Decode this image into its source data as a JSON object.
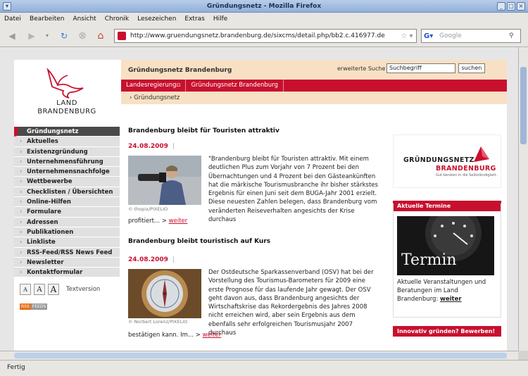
{
  "window": {
    "title": "Gründungsnetz - Mozilla Firefox"
  },
  "menu": [
    "Datei",
    "Bearbeiten",
    "Ansicht",
    "Chronik",
    "Lesezeichen",
    "Extras",
    "Hilfe"
  ],
  "toolbar": {
    "url": "http://www.gruendungsnetz.brandenburg.de/sixcms/detail.php/bb2.c.416977.de",
    "search_placeholder": "Google"
  },
  "status": "Fertig",
  "site": {
    "logo_line1": "LAND",
    "logo_line2": "BRANDENBURG",
    "title": "Gründungsnetz Brandenburg",
    "advanced_search": "erweiterte Suche",
    "search_value": "Suchbegriff",
    "search_button": "suchen",
    "redbar": [
      "Landesregierung",
      "Gründungsnetz Brandenburg"
    ],
    "breadcrumb": "Gründungsnetz"
  },
  "nav": [
    "Gründungsnetz",
    "Aktuelles",
    "Existenzgründung",
    "Unternehmensführung",
    "Unternehmensnachfolge",
    "Wettbewerbe",
    "Checklisten / Übersichten",
    "Online-Hilfen",
    "Formulare",
    "Adressen",
    "Publikationen",
    "Linkliste",
    "RSS-Feed/RSS News Feed",
    "Newsletter",
    "Kontaktformular"
  ],
  "font_controls": {
    "labels": [
      "A",
      "A",
      "A"
    ],
    "textversion": "Textversion"
  },
  "rss_badge": [
    "RSS",
    "FEEDS"
  ],
  "articles": [
    {
      "title": "Brandenburg bleibt für Touristen attraktiv",
      "date": "24.08.2009",
      "credit": "© thopix/PIXELIO",
      "text": "\"Brandenburg bleibt für Touristen attraktiv. Mit einem deutlichen Plus zum Vorjahr von 7 Prozent bei den Übernachtungen und 4 Prozent bei den Gästeankünften hat die märkische Tourismusbranche ihr bisher stärkstes Ergebnis für einen Juni seit dem BUGA-Jahr 2001 erzielt. Diese neuesten Zahlen belegen, dass Brandenburg vom veränderten Reiseverhalten angesichts der Krise durchaus",
      "more_prefix": "profitiert... >",
      "more_link": "weiter"
    },
    {
      "title": "Brandenburg bleibt touristisch auf Kurs",
      "date": "24.08.2009",
      "credit": "© Norbert Lorenz/PIXELIO",
      "text": "Der Ostdeutsche Sparkassenverband (OSV) hat bei der Vorstellung des Tourismus-Barometers für 2009 eine erste Prognose für das laufende Jahr gewagt. Der OSV geht davon aus, dass Brandenburg angesichts der Wirtschaftskrise das Rekordergebnis des Jahres 2008 nicht erreichen wird, aber sein Ergebnis aus dem ebenfalls sehr erfolgreichen Tourismusjahr 2007 durchaus",
      "more_prefix": "bestätigen kann. Im... >",
      "more_link": "weiter"
    }
  ],
  "right": {
    "logo_line1": "GRÜNDUNGSNETZ",
    "logo_line2": "BRANDENBURG",
    "logo_tagline": "Gut beraten in die Selbständigkeit.",
    "termine_head": "Aktuelle Termine",
    "termin_word": "Termin",
    "termine_text": "Aktuelle Veranstaltungen und Beratungen im Land Brandenburg:",
    "termine_link": "weiter",
    "innovativ_head": "Innovativ gründen? Bewerben!"
  }
}
